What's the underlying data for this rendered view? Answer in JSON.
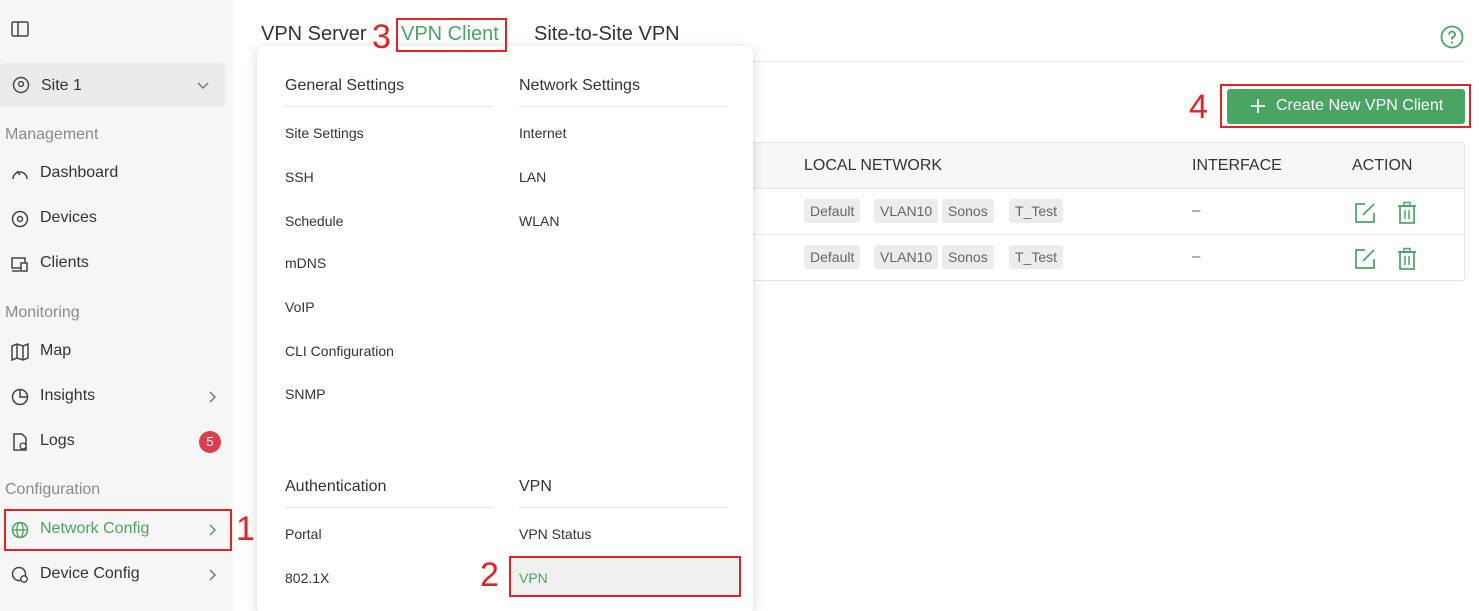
{
  "sidebar": {
    "site_label": "Site 1",
    "sections": {
      "management": "Management",
      "monitoring": "Monitoring",
      "configuration": "Configuration"
    },
    "items": {
      "dashboard": "Dashboard",
      "devices": "Devices",
      "clients": "Clients",
      "map": "Map",
      "insights": "Insights",
      "logs": "Logs",
      "network_config": "Network Config",
      "device_config": "Device Config"
    },
    "logs_badge": "5"
  },
  "tabs": [
    "VPN Server",
    "VPN Client",
    "Site-to-Site VPN"
  ],
  "create_button": "Create New VPN Client",
  "table": {
    "headers": [
      "LOCAL NETWORK",
      "INTERFACE",
      "ACTION"
    ],
    "rows": [
      {
        "tags": [
          "Default",
          "VLAN10",
          "Sonos",
          "T_Test"
        ],
        "interface": "–"
      },
      {
        "tags": [
          "Default",
          "VLAN10",
          "Sonos",
          "T_Test"
        ],
        "interface": "–"
      }
    ]
  },
  "menu": {
    "general_settings": {
      "title": "General Settings",
      "items": [
        "Site Settings",
        "SSH",
        "Schedule",
        "mDNS",
        "VoIP",
        "CLI Configuration",
        "SNMP"
      ]
    },
    "network_settings": {
      "title": "Network Settings",
      "items": [
        "Internet",
        "LAN",
        "WLAN"
      ]
    },
    "authentication": {
      "title": "Authentication",
      "items": [
        "Portal",
        "802.1X"
      ]
    },
    "vpn": {
      "title": "VPN",
      "items": [
        "VPN Status",
        "VPN"
      ]
    }
  },
  "annotations": [
    "1",
    "2",
    "3",
    "4"
  ],
  "colors": {
    "accent": "#4aa564",
    "annotation": "#e02424",
    "badge": "#d93f4c"
  }
}
